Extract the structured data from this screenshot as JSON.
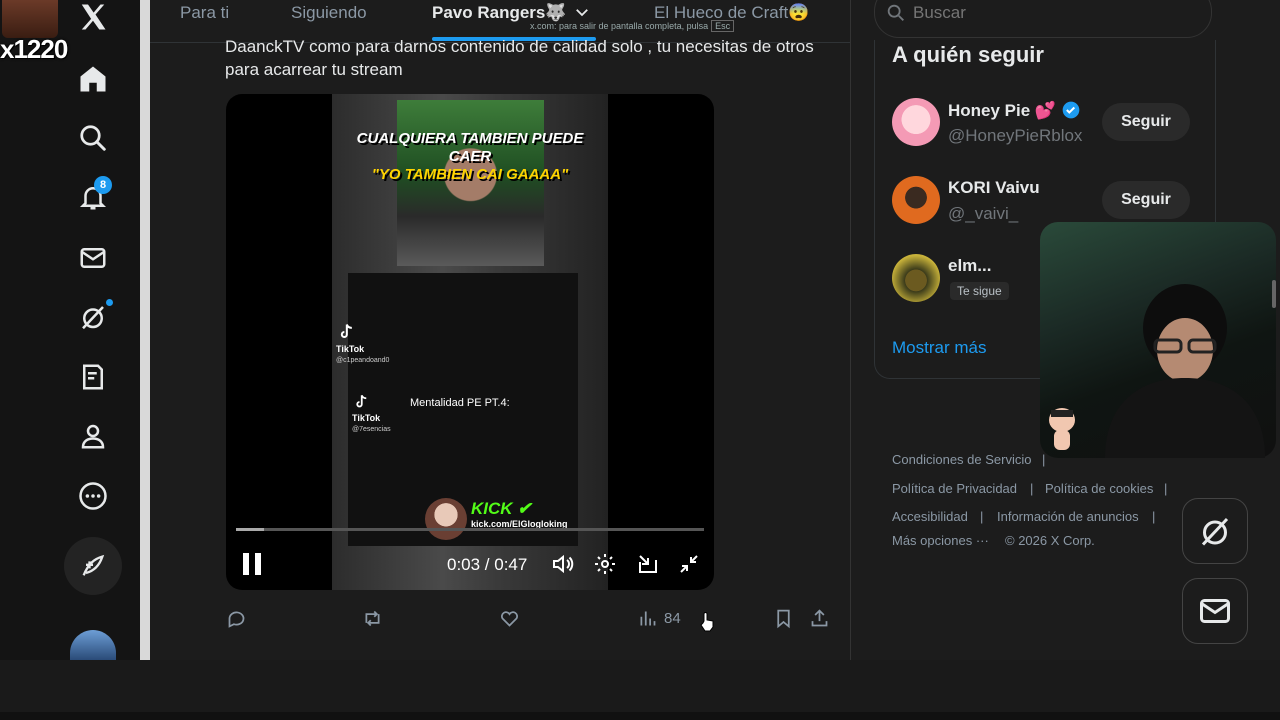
{
  "streamer": {
    "name": "x1220"
  },
  "nav": {
    "notifications_count": "8"
  },
  "tabs": [
    {
      "label": "Para ti"
    },
    {
      "label": "Siguiendo"
    },
    {
      "label": "Pavo Rangers🐺"
    },
    {
      "label": "El Hueco de Craft😨"
    }
  ],
  "fullscreen_hint": {
    "text": "x.com: para salir de pantalla completa, pulsa",
    "key": "Esc"
  },
  "tweet": {
    "text": "DaanckTV como para darnos contenido de calidad solo , tu necesitas de otros para acarrear tu stream"
  },
  "video": {
    "caption_line1": "CUALQUIERA TAMBIEN PUEDE CAER",
    "caption_line2": "\"YO TAMBIEN CAI GAAAA\"",
    "tiktok_1_label": "TikTok",
    "tiktok_1_handle": "@c1peandoand0",
    "tiktok_2_label": "TikTok",
    "tiktok_2_handle": "@7esencias",
    "subtitle": "Mentalidad PE PT.4:",
    "kick_logo": "KICK",
    "kick_url": "kick.com/ElGlogloking",
    "time": "0:03 / 0:47",
    "progress": 0.06
  },
  "actions": {
    "views": "84"
  },
  "search": {
    "placeholder": "Buscar"
  },
  "who_to_follow": {
    "title": "A quién seguir",
    "users": [
      {
        "name": "Honey Pie 💕",
        "handle": "@HoneyPieRblox",
        "button": "Seguir",
        "verified": true
      },
      {
        "name": "KORI Vaivu",
        "handle": "@_vaivi_",
        "button": "Seguir"
      },
      {
        "name": "elm...",
        "badge": "Te sigue"
      }
    ],
    "show_more": "Mostrar más"
  },
  "footer": {
    "terms": "Condiciones de Servicio",
    "privacy": "Política de Privacidad",
    "cookies": "Política de cookies",
    "accessibility": "Accesibilidad",
    "ads_info": "Información de anuncios",
    "more": "Más opciones ···",
    "copyright": "© 2026 X Corp."
  },
  "colors": {
    "accent": "#1d9bf0",
    "kick": "#53fc18",
    "background": "#1c1c1c"
  }
}
